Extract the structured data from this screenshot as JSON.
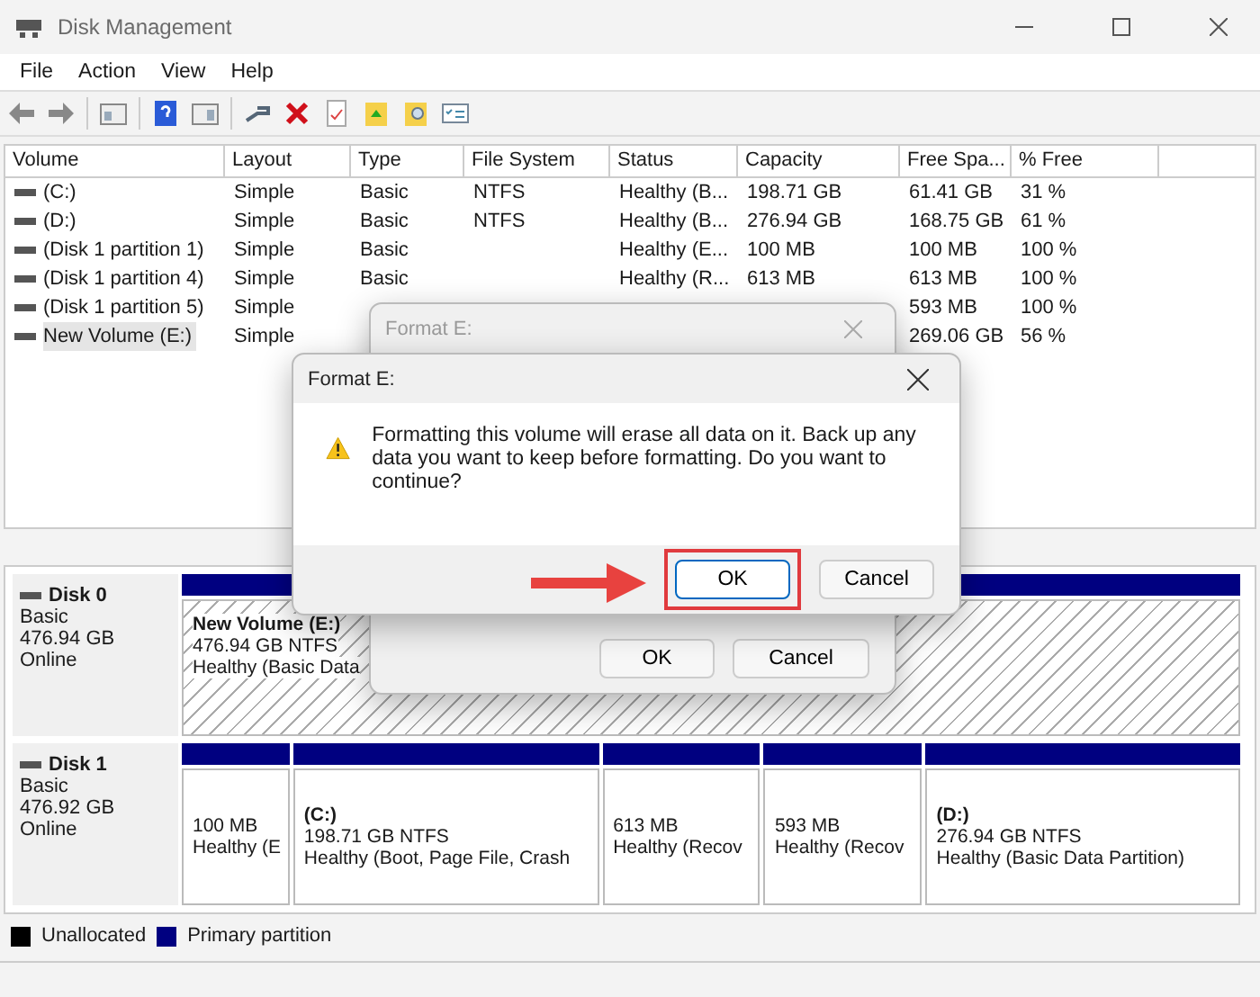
{
  "window": {
    "title": "Disk Management"
  },
  "menu": [
    "File",
    "Action",
    "View",
    "Help"
  ],
  "table": {
    "columns": [
      "Volume",
      "Layout",
      "Type",
      "File System",
      "Status",
      "Capacity",
      "Free Spa...",
      "% Free"
    ],
    "rows": [
      {
        "cells": [
          "(C:)",
          "Simple",
          "Basic",
          "NTFS",
          "Healthy (B...",
          "198.71 GB",
          "61.41 GB",
          "31 %"
        ],
        "selected": false
      },
      {
        "cells": [
          "(D:)",
          "Simple",
          "Basic",
          "NTFS",
          "Healthy (B...",
          "276.94 GB",
          "168.75 GB",
          "61 %"
        ],
        "selected": false
      },
      {
        "cells": [
          "(Disk 1 partition 1)",
          "Simple",
          "Basic",
          null,
          "Healthy (E...",
          "100 MB",
          "100 MB",
          "100 %"
        ],
        "selected": false
      },
      {
        "cells": [
          "(Disk 1 partition 4)",
          "Simple",
          "Basic",
          null,
          "Healthy (R...",
          "613 MB",
          "613 MB",
          "100 %"
        ],
        "selected": false
      },
      {
        "cells": [
          "(Disk 1 partition 5)",
          "Simple",
          null,
          null,
          null,
          null,
          "593 MB",
          "100 %"
        ],
        "selected": false
      },
      {
        "cells": [
          "New Volume (E:)",
          "Simple",
          null,
          null,
          null,
          null,
          "269.06 GB",
          "56 %"
        ],
        "selected": true
      }
    ]
  },
  "disks": [
    {
      "name": "Disk 0",
      "type": "Basic",
      "size": "476.94 GB",
      "state": "Online",
      "partitions": [
        {
          "label": "New Volume  (E:)",
          "size": "476.94 GB NTFS",
          "status": "Healthy (Basic Data",
          "selected": true
        }
      ]
    },
    {
      "name": "Disk 1",
      "type": "Basic",
      "size": "476.92 GB",
      "state": "Online",
      "partitions": [
        {
          "size": "100 MB",
          "status": "Healthy (E",
          "selected": false
        },
        {
          "label": "(C:)",
          "size": "198.71 GB NTFS",
          "status": "Healthy (Boot, Page File, Crash",
          "selected": false
        },
        {
          "size": "613 MB",
          "status": "Healthy (Recov",
          "selected": false
        },
        {
          "size": "593 MB",
          "status": "Healthy (Recov",
          "selected": false
        },
        {
          "label": "(D:)",
          "size": "276.94 GB NTFS",
          "status": "Healthy (Basic Data Partition)",
          "selected": false
        }
      ]
    }
  ],
  "legend": [
    {
      "label": "Unallocated",
      "color": "#000000"
    },
    {
      "label": "Primary partition",
      "color": "#000080"
    }
  ],
  "back_dialog": {
    "title": "Format E:",
    "buttons": [
      {
        "label": "OK",
        "default": false
      },
      {
        "label": "Cancel",
        "default": false
      }
    ]
  },
  "dialog": {
    "title": "Format E:",
    "message": "Formatting this volume will erase all data on it. Back up any data you want to keep before formatting. Do you want to continue?",
    "buttons": [
      {
        "label": "OK",
        "default": true,
        "highlighted": true
      },
      {
        "label": "Cancel",
        "default": false,
        "highlighted": false
      }
    ]
  }
}
